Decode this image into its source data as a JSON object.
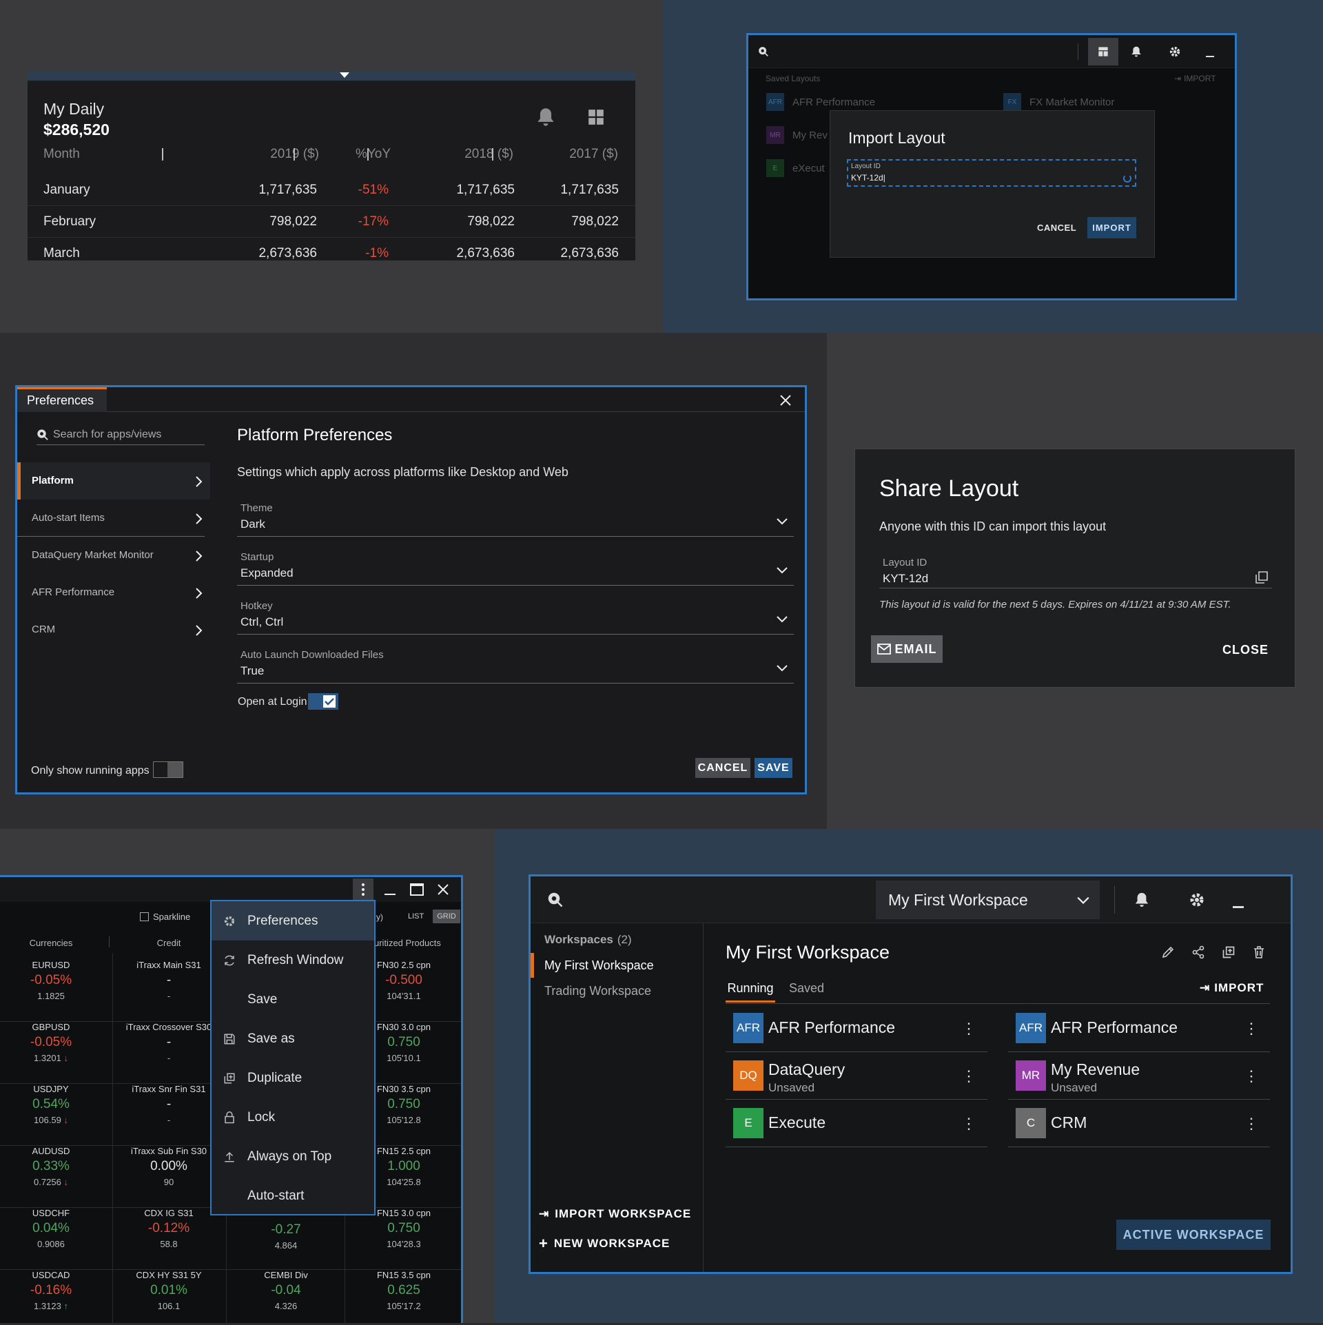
{
  "daily": {
    "title": "My Daily",
    "amount": "$286,520",
    "headers": [
      "Month",
      "2019 ($)",
      "%YoY",
      "2018 ($)",
      "2017 ($)"
    ],
    "rows": [
      {
        "month": "January",
        "y2019": "1,717,635",
        "yoy": "-51%",
        "y2018": "1,717,635",
        "y2017": "1,717,635"
      },
      {
        "month": "February",
        "y2019": "798,022",
        "yoy": "-17%",
        "y2018": "798,022",
        "y2017": "798,022"
      },
      {
        "month": "March",
        "y2019": "2,673,636",
        "yoy": "-1%",
        "y2018": "2,673,636",
        "y2017": "2,673,636"
      }
    ]
  },
  "import_layout": {
    "saved_layouts_label": "Saved Layouts",
    "import_link": "IMPORT",
    "bg_items": [
      {
        "badge": "AFR",
        "name": "AFR Performance"
      },
      {
        "badge": "FX",
        "name": "FX Market Monitor"
      },
      {
        "badge": "MR",
        "name": "My Rev"
      },
      {
        "badge": "E",
        "name": "eXecut"
      }
    ],
    "dialog_title": "Import Layout",
    "field_label": "Layout ID",
    "field_value": "KYT-12d|",
    "cancel": "CANCEL",
    "import": "IMPORT"
  },
  "preferences": {
    "tab": "Preferences",
    "search_placeholder": "Search for apps/views",
    "menu": [
      "Platform",
      "Auto-start Items",
      "DataQuery Market Monitor",
      "AFR Performance",
      "CRM"
    ],
    "heading": "Platform Preferences",
    "description": "Settings which apply across platforms like Desktop and Web",
    "fields": [
      {
        "label": "Theme",
        "value": "Dark"
      },
      {
        "label": "Startup",
        "value": "Expanded"
      },
      {
        "label": "Hotkey",
        "value": "Ctrl, Ctrl"
      },
      {
        "label": "Auto Launch Downloaded Files",
        "value": "True"
      }
    ],
    "open_at_login": "Open at Login",
    "only_running": "Only show running apps",
    "cancel": "CANCEL",
    "save": "SAVE"
  },
  "share": {
    "title": "Share Layout",
    "desc": "Anyone with this ID can import this layout",
    "field_label": "Layout ID",
    "field_value": "KYT-12d",
    "note": "This layout id is valid for the next 5 days. Expires on 4/11/21 at 9:30 AM EST.",
    "email": "EMAIL",
    "close": "CLOSE"
  },
  "monitor": {
    "sparkline": "Sparkline",
    "partial_label": "y)",
    "list": "LIST",
    "grid": "GRID",
    "col_headers": [
      "Currencies",
      "Credit",
      "uritized Products"
    ],
    "rows": [
      {
        "c": [
          "EURUSD",
          "-0.05%",
          "1.1825"
        ],
        "cr": [
          "iTraxx Main S31",
          "-",
          "-"
        ],
        "sp": [
          "FN30 2.5 cpn",
          "-0.500",
          "104'31.1"
        ],
        "cc": "neg",
        "sc": "neg"
      },
      {
        "c": [
          "GBPUSD",
          "-0.05%",
          "1.3201"
        ],
        "cr": [
          "iTraxx Crossover S30",
          "-",
          "-"
        ],
        "sp": [
          "FN30 3.0 cpn",
          "0.750",
          "105'10.1"
        ],
        "cc": "neg",
        "sc": "pos"
      },
      {
        "c": [
          "USDJPY",
          "0.54%",
          "106.59"
        ],
        "cr": [
          "iTraxx Snr Fin S31",
          "-",
          "-"
        ],
        "sp": [
          "FN30 3.5 cpn",
          "0.750",
          "105'12.8"
        ],
        "cc": "pos",
        "sc": "pos"
      },
      {
        "c": [
          "AUDUSD",
          "0.33%",
          "0.7256"
        ],
        "cr": [
          "iTraxx Sub Fin S30",
          "0.00%",
          "90"
        ],
        "sp": [
          "FN15 2.5 cpn",
          "1.000",
          "104'25.8"
        ],
        "cc": "pos",
        "sc": "pos"
      },
      {
        "c": [
          "USDCHF",
          "0.04%",
          "0.9086"
        ],
        "cr": [
          "CDX IG S31",
          "-0.12%",
          "58.8"
        ],
        "mid": [
          "-0.27",
          "4.864"
        ],
        "sp": [
          "FN15 3.0 cpn",
          "0.750",
          "104'28.3"
        ],
        "cc": "pos",
        "crc": "neg",
        "sc": "pos"
      },
      {
        "c": [
          "USDCAD",
          "-0.16%",
          "1.3123"
        ],
        "cr": [
          "CDX HY S31 5Y",
          "0.01%",
          "106.1"
        ],
        "mid": [
          "CEMBI Div",
          "-0.04",
          "4.326"
        ],
        "sp": [
          "FN15 3.5 cpn",
          "0.625",
          "105'17.2"
        ],
        "cc": "neg",
        "crc": "pos",
        "sc": "pos"
      }
    ],
    "context_menu": [
      "Preferences",
      "Refresh Window",
      "Save",
      "Save as",
      "Duplicate",
      "Lock",
      "Always on Top",
      "Auto-start"
    ]
  },
  "workspace": {
    "selected": "My First Workspace",
    "list_label": "Workspaces",
    "count": "(2)",
    "items": [
      "My First Workspace",
      "Trading Workspace"
    ],
    "title": "My First Workspace",
    "tabs": [
      "Running",
      "Saved"
    ],
    "import": "IMPORT",
    "apps": [
      {
        "badge": "AFR",
        "name": "AFR Performance",
        "sub": "",
        "color": "#2b6aa8"
      },
      {
        "badge": "AFR",
        "name": "AFR Performance",
        "sub": "",
        "color": "#2b6aa8"
      },
      {
        "badge": "DQ",
        "name": "DataQuery",
        "sub": "Unsaved",
        "color": "#e2711d"
      },
      {
        "badge": "MR",
        "name": "My Revenue",
        "sub": "Unsaved",
        "color": "#9b3fae"
      },
      {
        "badge": "E",
        "name": "Execute",
        "sub": "",
        "color": "#2a9d4a"
      },
      {
        "badge": "C",
        "name": "CRM",
        "sub": "",
        "color": "#6b6b6b"
      }
    ],
    "import_workspace": "IMPORT WORKSPACE",
    "new_workspace": "NEW WORKSPACE",
    "active_workspace": "ACTIVE WORKSPACE"
  }
}
